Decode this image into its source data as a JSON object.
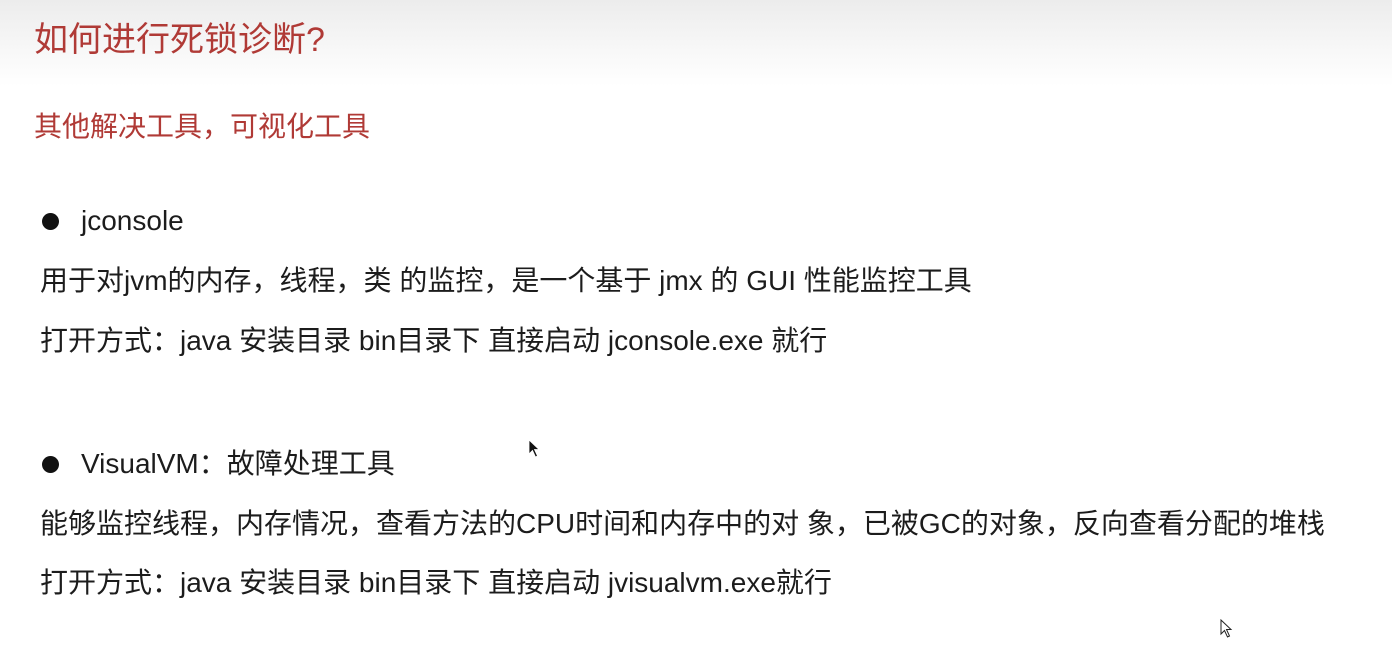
{
  "slide": {
    "title": "如何进行死锁诊断?",
    "subtitle": "其他解决工具，可视化工具",
    "sections": [
      {
        "heading": "jconsole",
        "lines": [
          "用于对jvm的内存，线程，类 的监控，是一个基于 jmx 的 GUI 性能监控工具",
          "打开方式：java 安装目录 bin目录下 直接启动 jconsole.exe 就行"
        ]
      },
      {
        "heading": "VisualVM：故障处理工具",
        "lines": [
          "能够监控线程，内存情况，查看方法的CPU时间和内存中的对 象，已被GC的对象，反向查看分配的堆栈",
          "打开方式：java 安装目录 bin目录下 直接启动 jvisualvm.exe就行"
        ]
      }
    ]
  },
  "colors": {
    "accent": "#b03a36",
    "body_text": "#1c1c1c",
    "background": "#ffffff"
  },
  "icons": {
    "bullet": "bullet-dot",
    "pointer_1": "mouse-pointer-icon",
    "pointer_2": "mouse-pointer-outline-icon"
  }
}
